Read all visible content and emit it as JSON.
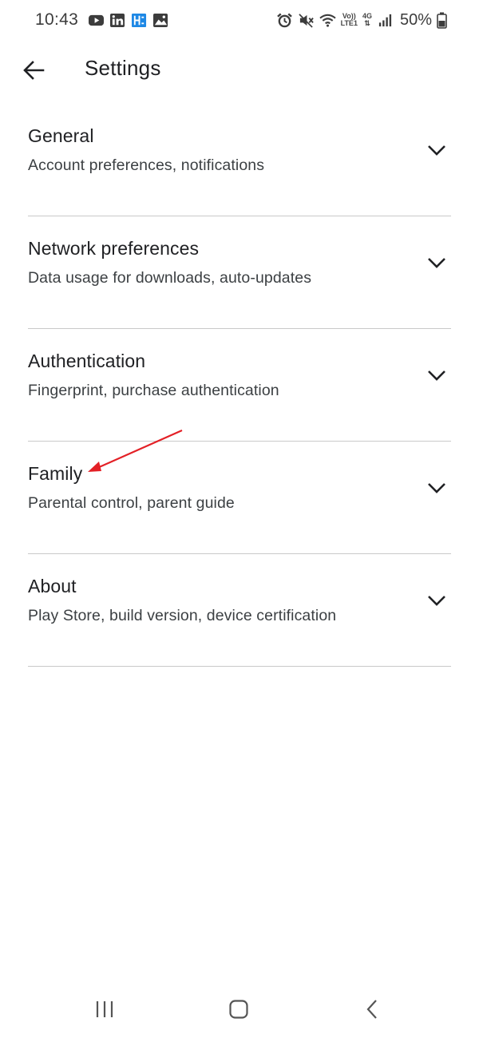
{
  "status_bar": {
    "time": "10:43",
    "network_top": "Vo))",
    "network_bottom": "LTE1",
    "network_gen": "4G",
    "battery": "50%"
  },
  "app_bar": {
    "title": "Settings",
    "back_icon": "arrow-back-icon"
  },
  "settings": [
    {
      "title": "General",
      "subtitle": "Account preferences, notifications"
    },
    {
      "title": "Network preferences",
      "subtitle": "Data usage for downloads, auto-updates"
    },
    {
      "title": "Authentication",
      "subtitle": "Fingerprint, purchase authentication"
    },
    {
      "title": "Family",
      "subtitle": "Parental control, parent guide"
    },
    {
      "title": "About",
      "subtitle": "Play Store, build version, device certification"
    }
  ],
  "annotation": {
    "color": "#e32026"
  },
  "colors": {
    "text_primary": "#202124",
    "text_secondary": "#3c4043",
    "divider": "#c9c9c9"
  }
}
